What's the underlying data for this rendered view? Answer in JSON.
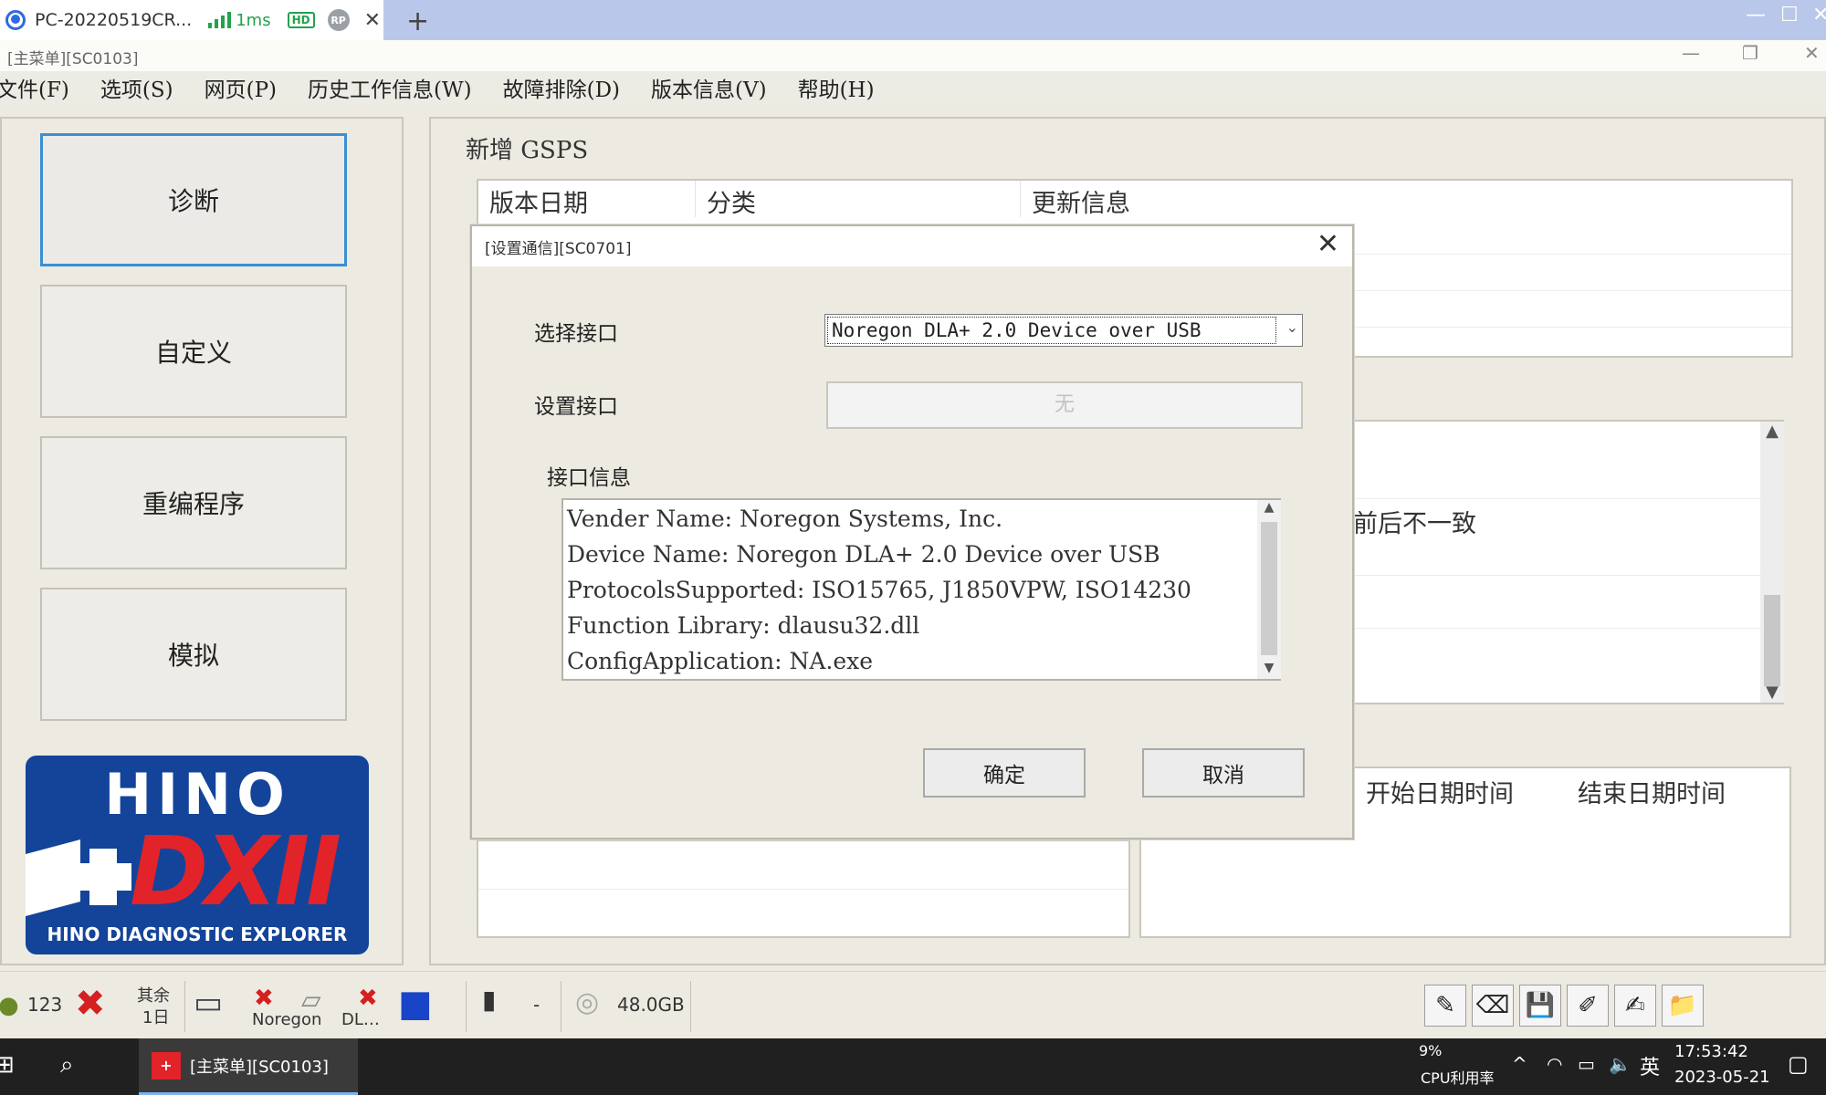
{
  "remote_tab": {
    "title": "PC-20220519CR...",
    "ping": "1ms",
    "hd_badge": "HD",
    "rp_badge": "RP",
    "close": "✕",
    "add": "+"
  },
  "app": {
    "title": "[主菜单][SC0103]"
  },
  "menu": [
    "文件(F)",
    "选项(S)",
    "网页(P)",
    "历史工作信息(W)",
    "故障排除(D)",
    "版本信息(V)",
    "帮助(H)"
  ],
  "nav": {
    "diagnose": "诊断",
    "custom": "自定义",
    "reprogram": "重编程序",
    "simulate": "模拟"
  },
  "logo": {
    "brand": "HINO",
    "product": "DXII",
    "tagline": "HINO DIAGNOSTIC EXPLORER"
  },
  "main": {
    "heading": "新增 GSPS",
    "gsps_columns": [
      "版本日期",
      "分类",
      "更新信息"
    ],
    "notice_partial": "前后不一致",
    "bottom_columns": [
      "开始日期时间",
      "结束日期时间"
    ]
  },
  "dialog": {
    "title": "[设置通信][SC0701]",
    "close": "✕",
    "select_interface_label": "选择接口",
    "select_interface_value": "Noregon DLA+ 2.0 Device over USB",
    "setup_interface_label": "设置接口",
    "setup_interface_value": "无",
    "interface_info_label": "接口信息",
    "info_lines": [
      "Vender Name:  Noregon Systems, Inc.",
      "Device Name:  Noregon DLA+ 2.0 Device over USB",
      "ProtocolsSupported: ISO15765, J1850VPW, ISO14230",
      "Function Library:  dlausu32.dll",
      "ConfigApplication: NA.exe"
    ],
    "ok_button": "确定",
    "cancel_button": "取消"
  },
  "statusbar": {
    "count": "123",
    "remaining_label": "其余",
    "remaining_value": "1日",
    "noregon_label": "Noregon",
    "dl_label": "DL…",
    "dash": "-",
    "disk": "48.0GB"
  },
  "taskbar": {
    "app_label": "[主菜单][SC0103]",
    "cpu_percent": "9%",
    "cpu_label": "CPU利用率",
    "ime": "英",
    "time": "17:53:42",
    "date": "2023-05-21"
  },
  "colors": {
    "accent_blue": "#3a8fd3",
    "logo_blue": "#13449a",
    "logo_red": "#e2232a",
    "signal_green": "#23a24d"
  }
}
